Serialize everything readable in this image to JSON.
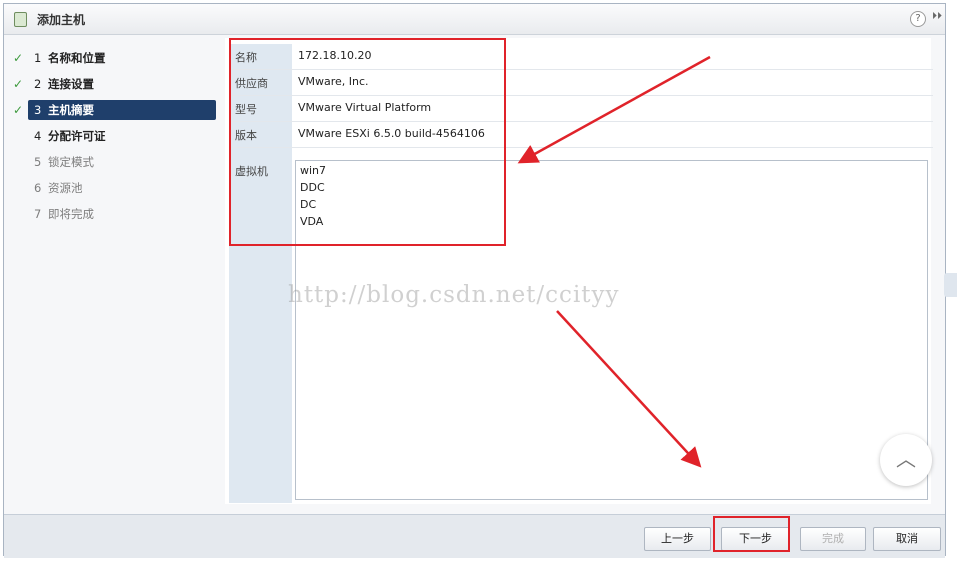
{
  "window": {
    "title": "添加主机",
    "help_glyph": "?",
    "expand_glyph": "⏵⏵"
  },
  "steps": [
    {
      "num": "1",
      "label": "名称和位置",
      "state": "done"
    },
    {
      "num": "2",
      "label": "连接设置",
      "state": "done"
    },
    {
      "num": "3",
      "label": "主机摘要",
      "state": "current"
    },
    {
      "num": "4",
      "label": "分配许可证",
      "state": "active"
    },
    {
      "num": "5",
      "label": "锁定模式",
      "state": "future"
    },
    {
      "num": "6",
      "label": "资源池",
      "state": "future"
    },
    {
      "num": "7",
      "label": "即将完成",
      "state": "future"
    }
  ],
  "summary": {
    "name_key": "名称",
    "name_val": "172.18.10.20",
    "vendor_key": "供应商",
    "vendor_val": "VMware, Inc.",
    "model_key": "型号",
    "model_val": "VMware Virtual Platform",
    "version_key": "版本",
    "version_val": "VMware ESXi 6.5.0 build-4564106",
    "vm_key": "虚拟机",
    "vms": [
      "win7",
      "DDC",
      "DC",
      "VDA"
    ]
  },
  "watermark": "http://blog.csdn.net/ccityy",
  "footer": {
    "back": "上一步",
    "next": "下一步",
    "finish": "完成",
    "cancel": "取消"
  },
  "colors": {
    "annotation_red": "#e0232a",
    "current_step_bg": "#1f3f6b",
    "check_green": "#3d9a3d"
  }
}
